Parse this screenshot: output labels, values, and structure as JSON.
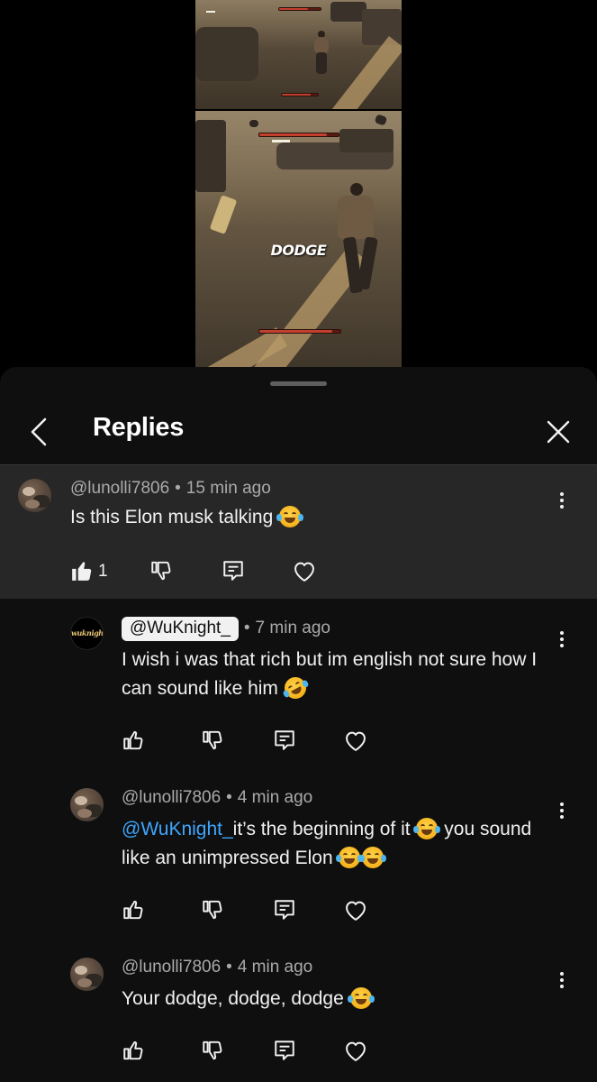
{
  "video": {
    "overlay_text": "DODGE"
  },
  "sheet": {
    "title": "Replies"
  },
  "comments": [
    {
      "author": "@lunolli7806",
      "time": "15 min ago",
      "text": "Is this Elon musk talking",
      "emojis": [
        "joy"
      ],
      "likes": "1",
      "liked": true,
      "highlighted": true
    },
    {
      "author": "@WuKnight_",
      "author_is_creator": true,
      "avatar_text": "wuknight",
      "time": "7 min ago",
      "text": "I wish i was that rich but im english not sure how I can sound like him",
      "emojis": [
        "rofl"
      ]
    },
    {
      "author": "@lunolli7806",
      "time": "4 min ago",
      "mention": "@WuKnight_",
      "text_part1": "it’s the beginning of it",
      "text_part2": "you sound like an unimpressed Elon",
      "emojis": [
        "joy",
        "joy",
        "joy"
      ]
    },
    {
      "author": "@lunolli7806",
      "time": "4 min ago",
      "text": "Your dodge, dodge, dodge",
      "emojis": [
        "joy"
      ]
    }
  ],
  "colors": {
    "sheet_bg": "#0f0f0f",
    "highlight_bg": "#272727",
    "mention": "#3ea6ff",
    "meta_text": "#aaaaaa"
  },
  "icons": [
    "back-chevron-icon",
    "close-icon",
    "more-vert-icon",
    "thumb-up-icon",
    "thumb-down-icon",
    "reply-icon",
    "heart-icon"
  ]
}
